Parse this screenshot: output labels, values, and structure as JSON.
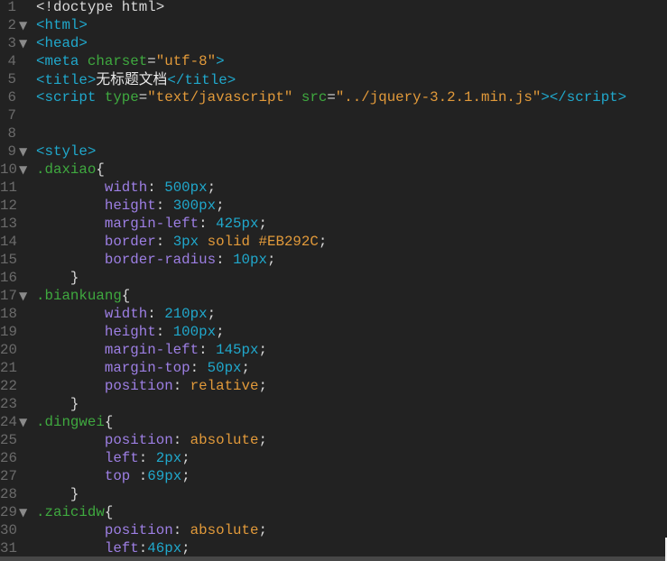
{
  "colors": {
    "background": "#222222",
    "tag": "#20a8cc",
    "attribute": "#3fa93f",
    "string": "#e29a3a",
    "property": "#9d7fe4",
    "number": "#20a8cc",
    "selector": "#3fa93f"
  },
  "lines": [
    {
      "n": "1",
      "fold": false,
      "tokens": [
        [
          "plain",
          "<!doctype html>"
        ]
      ]
    },
    {
      "n": "2",
      "fold": true,
      "tokens": [
        [
          "tag",
          "<html>"
        ]
      ]
    },
    {
      "n": "3",
      "fold": true,
      "tokens": [
        [
          "tag",
          "<head>"
        ]
      ]
    },
    {
      "n": "4",
      "fold": false,
      "tokens": [
        [
          "tag",
          "<meta "
        ],
        [
          "attr",
          "charset"
        ],
        [
          "plain",
          "="
        ],
        [
          "str",
          "\"utf-8\""
        ],
        [
          "tag",
          ">"
        ]
      ]
    },
    {
      "n": "5",
      "fold": false,
      "tokens": [
        [
          "tag",
          "<title>"
        ],
        [
          "cjk",
          "无标题文档"
        ],
        [
          "tag",
          "</title>"
        ]
      ]
    },
    {
      "n": "6",
      "fold": false,
      "tokens": [
        [
          "tag",
          "<script "
        ],
        [
          "attr",
          "type"
        ],
        [
          "plain",
          "="
        ],
        [
          "str",
          "\"text/javascript\" "
        ],
        [
          "attr",
          "src"
        ],
        [
          "plain",
          "="
        ],
        [
          "str",
          "\"../jquery-3.2.1.min.js\""
        ],
        [
          "tag",
          "></script>"
        ]
      ]
    },
    {
      "n": "7",
      "fold": false,
      "tokens": []
    },
    {
      "n": "8",
      "fold": false,
      "tokens": []
    },
    {
      "n": "9",
      "fold": true,
      "tokens": [
        [
          "tag",
          "<style>"
        ]
      ]
    },
    {
      "n": "10",
      "fold": true,
      "tokens": [
        [
          "sel",
          ".daxiao"
        ],
        [
          "plain",
          "{"
        ]
      ]
    },
    {
      "n": "11",
      "fold": false,
      "tokens": [
        [
          "plain",
          "        "
        ],
        [
          "prop",
          "width"
        ],
        [
          "plain",
          ": "
        ],
        [
          "num",
          "500px"
        ],
        [
          "plain",
          ";"
        ]
      ]
    },
    {
      "n": "12",
      "fold": false,
      "tokens": [
        [
          "plain",
          "        "
        ],
        [
          "prop",
          "height"
        ],
        [
          "plain",
          ": "
        ],
        [
          "num",
          "300px"
        ],
        [
          "plain",
          ";"
        ]
      ]
    },
    {
      "n": "13",
      "fold": false,
      "tokens": [
        [
          "plain",
          "        "
        ],
        [
          "prop",
          "margin-left"
        ],
        [
          "plain",
          ": "
        ],
        [
          "num",
          "425px"
        ],
        [
          "plain",
          ";"
        ]
      ]
    },
    {
      "n": "14",
      "fold": false,
      "tokens": [
        [
          "plain",
          "        "
        ],
        [
          "prop",
          "border"
        ],
        [
          "plain",
          ": "
        ],
        [
          "num",
          "3px"
        ],
        [
          "val",
          " solid #EB292C"
        ],
        [
          "plain",
          ";"
        ]
      ]
    },
    {
      "n": "15",
      "fold": false,
      "tokens": [
        [
          "plain",
          "        "
        ],
        [
          "prop",
          "border-radius"
        ],
        [
          "plain",
          ": "
        ],
        [
          "num",
          "10px"
        ],
        [
          "plain",
          ";"
        ]
      ]
    },
    {
      "n": "16",
      "fold": false,
      "tokens": [
        [
          "plain",
          "    }"
        ]
      ]
    },
    {
      "n": "17",
      "fold": true,
      "tokens": [
        [
          "sel",
          ".biankuang"
        ],
        [
          "plain",
          "{"
        ]
      ]
    },
    {
      "n": "18",
      "fold": false,
      "tokens": [
        [
          "plain",
          "        "
        ],
        [
          "prop",
          "width"
        ],
        [
          "plain",
          ": "
        ],
        [
          "num",
          "210px"
        ],
        [
          "plain",
          ";"
        ]
      ]
    },
    {
      "n": "19",
      "fold": false,
      "tokens": [
        [
          "plain",
          "        "
        ],
        [
          "prop",
          "height"
        ],
        [
          "plain",
          ": "
        ],
        [
          "num",
          "100px"
        ],
        [
          "plain",
          ";"
        ]
      ]
    },
    {
      "n": "20",
      "fold": false,
      "tokens": [
        [
          "plain",
          "        "
        ],
        [
          "prop",
          "margin-left"
        ],
        [
          "plain",
          ": "
        ],
        [
          "num",
          "145px"
        ],
        [
          "plain",
          ";"
        ]
      ]
    },
    {
      "n": "21",
      "fold": false,
      "tokens": [
        [
          "plain",
          "        "
        ],
        [
          "prop",
          "margin-top"
        ],
        [
          "plain",
          ": "
        ],
        [
          "num",
          "50px"
        ],
        [
          "plain",
          ";"
        ]
      ]
    },
    {
      "n": "22",
      "fold": false,
      "tokens": [
        [
          "plain",
          "        "
        ],
        [
          "prop",
          "position"
        ],
        [
          "plain",
          ": "
        ],
        [
          "val",
          "relative"
        ],
        [
          "plain",
          ";"
        ]
      ]
    },
    {
      "n": "23",
      "fold": false,
      "tokens": [
        [
          "plain",
          "    }"
        ]
      ]
    },
    {
      "n": "24",
      "fold": true,
      "tokens": [
        [
          "sel",
          ".dingwei"
        ],
        [
          "plain",
          "{"
        ]
      ]
    },
    {
      "n": "25",
      "fold": false,
      "tokens": [
        [
          "plain",
          "        "
        ],
        [
          "prop",
          "position"
        ],
        [
          "plain",
          ": "
        ],
        [
          "val",
          "absolute"
        ],
        [
          "plain",
          ";"
        ]
      ]
    },
    {
      "n": "26",
      "fold": false,
      "tokens": [
        [
          "plain",
          "        "
        ],
        [
          "prop",
          "left"
        ],
        [
          "plain",
          ": "
        ],
        [
          "num",
          "2px"
        ],
        [
          "plain",
          ";"
        ]
      ]
    },
    {
      "n": "27",
      "fold": false,
      "tokens": [
        [
          "plain",
          "        "
        ],
        [
          "prop",
          "top"
        ],
        [
          "plain",
          " :"
        ],
        [
          "num",
          "69px"
        ],
        [
          "plain",
          ";"
        ]
      ]
    },
    {
      "n": "28",
      "fold": false,
      "tokens": [
        [
          "plain",
          "    }"
        ]
      ]
    },
    {
      "n": "29",
      "fold": true,
      "tokens": [
        [
          "sel",
          ".zaicidw"
        ],
        [
          "plain",
          "{"
        ]
      ]
    },
    {
      "n": "30",
      "fold": false,
      "tokens": [
        [
          "plain",
          "        "
        ],
        [
          "prop",
          "position"
        ],
        [
          "plain",
          ": "
        ],
        [
          "val",
          "absolute"
        ],
        [
          "plain",
          ";"
        ]
      ]
    },
    {
      "n": "31",
      "fold": false,
      "tokens": [
        [
          "plain",
          "        "
        ],
        [
          "prop",
          "left"
        ],
        [
          "plain",
          ":"
        ],
        [
          "num",
          "46px"
        ],
        [
          "plain",
          ";"
        ]
      ]
    }
  ]
}
